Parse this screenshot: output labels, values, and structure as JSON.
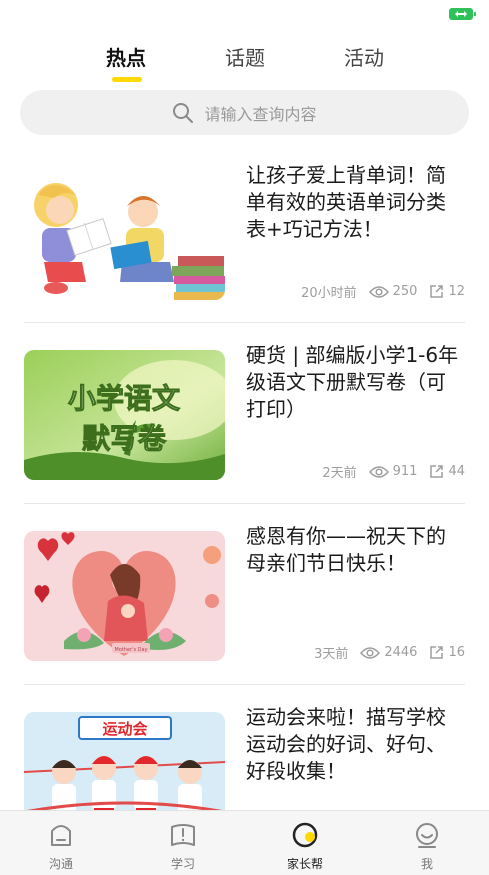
{
  "tabs": [
    {
      "label": "热点",
      "active": true
    },
    {
      "label": "话题",
      "active": false
    },
    {
      "label": "活动",
      "active": false
    }
  ],
  "search": {
    "placeholder": "请输入查询内容",
    "icon": "search-icon"
  },
  "articles": [
    {
      "title": "让孩子爱上背单词！简单有效的英语单词分类表+巧记方法！",
      "time": "20小时前",
      "views": "250",
      "shares": "12",
      "image": "kids-reading-illustration"
    },
    {
      "title": "硬货 | 部编版小学1-6年级语文下册默写卷（可打印）",
      "time": "2天前",
      "views": "911",
      "shares": "44",
      "image": "小学语文默写卷",
      "image_text": [
        "小学语文",
        "默写卷"
      ]
    },
    {
      "title": "感恩有你——祝天下的母亲们节日快乐！",
      "time": "3天前",
      "views": "2446",
      "shares": "16",
      "image": "mothers-day-illustration",
      "image_text": [
        "Mother's Day"
      ]
    },
    {
      "title": "运动会来啦！描写学校运动会的好词、好句、好段收集！",
      "image": "sports-day-illustration",
      "image_text": [
        "运动会"
      ]
    }
  ],
  "bottom_nav": [
    {
      "label": "沟通",
      "icon": "chat-icon",
      "active": false
    },
    {
      "label": "学习",
      "icon": "book-icon",
      "active": false
    },
    {
      "label": "家长帮",
      "icon": "parent-help-icon",
      "active": true
    },
    {
      "label": "我",
      "icon": "profile-icon",
      "active": false
    }
  ],
  "colors": {
    "accent": "#ffd900",
    "battery": "#2fc25b",
    "muted": "#9d9d9d"
  }
}
